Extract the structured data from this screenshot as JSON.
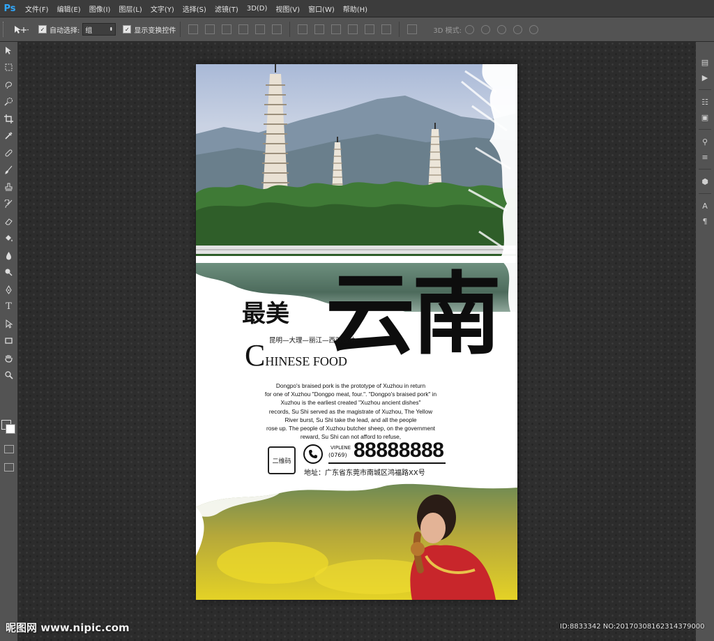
{
  "app": {
    "logo": "Ps",
    "menu": [
      "文件(F)",
      "编辑(E)",
      "图像(I)",
      "图层(L)",
      "文字(Y)",
      "选择(S)",
      "滤镜(T)",
      "3D(D)",
      "视图(V)",
      "窗口(W)",
      "帮助(H)"
    ]
  },
  "options": {
    "auto_select_label": "自动选择:",
    "auto_select_checked": true,
    "auto_select_value": "组",
    "show_transform_label": "显示变换控件",
    "show_transform_checked": true,
    "mode_3d_label": "3D 模式:"
  },
  "tools": [
    "move-tool",
    "marquee-tool",
    "lasso-tool",
    "quick-select-tool",
    "crop-tool",
    "eyedropper-tool",
    "healing-brush-tool",
    "brush-tool",
    "clone-stamp-tool",
    "history-brush-tool",
    "eraser-tool",
    "paint-bucket-tool",
    "blur-tool",
    "dodge-tool",
    "pen-tool",
    "type-tool",
    "path-select-tool",
    "rectangle-tool",
    "hand-tool",
    "zoom-tool"
  ],
  "colors": {
    "foreground": "#555555",
    "background": "#ffffff",
    "accent": "#31a8ff"
  },
  "poster": {
    "title_small": "最美",
    "title_big": "云南",
    "route": "昆明—大理—丽江—西双版纳",
    "english_cap": "C",
    "english_rest": "HINESE FOOD",
    "body_lines": [
      "Dongpo's braised pork is the prototype of Xuzhou in return",
      "for one of Xuzhou \"Dongpo meat, four.\". \"Dongpo's braised pork\" in",
      "Xuzhou is the earliest created \"Xuzhou ancient dishes\"",
      "records, Su Shi served as the magistrate of Xuzhou, The Yellow",
      "River burst, Su Shi take the lead, and all the people",
      "rose up. The people of Xuzhou butcher sheep, on the government",
      "reward, Su Shi can not afford to refuse,"
    ],
    "qr_label": "二维码",
    "viplene": "VIPLENE",
    "area_code": "(0769)",
    "phone": "88888888",
    "address": "地址：广东省东莞市南城区鸿福路XX号"
  },
  "watermark": {
    "left": "昵图网 www.nipic.com",
    "right": "ID:8833342 NO:20170308162314379000"
  }
}
